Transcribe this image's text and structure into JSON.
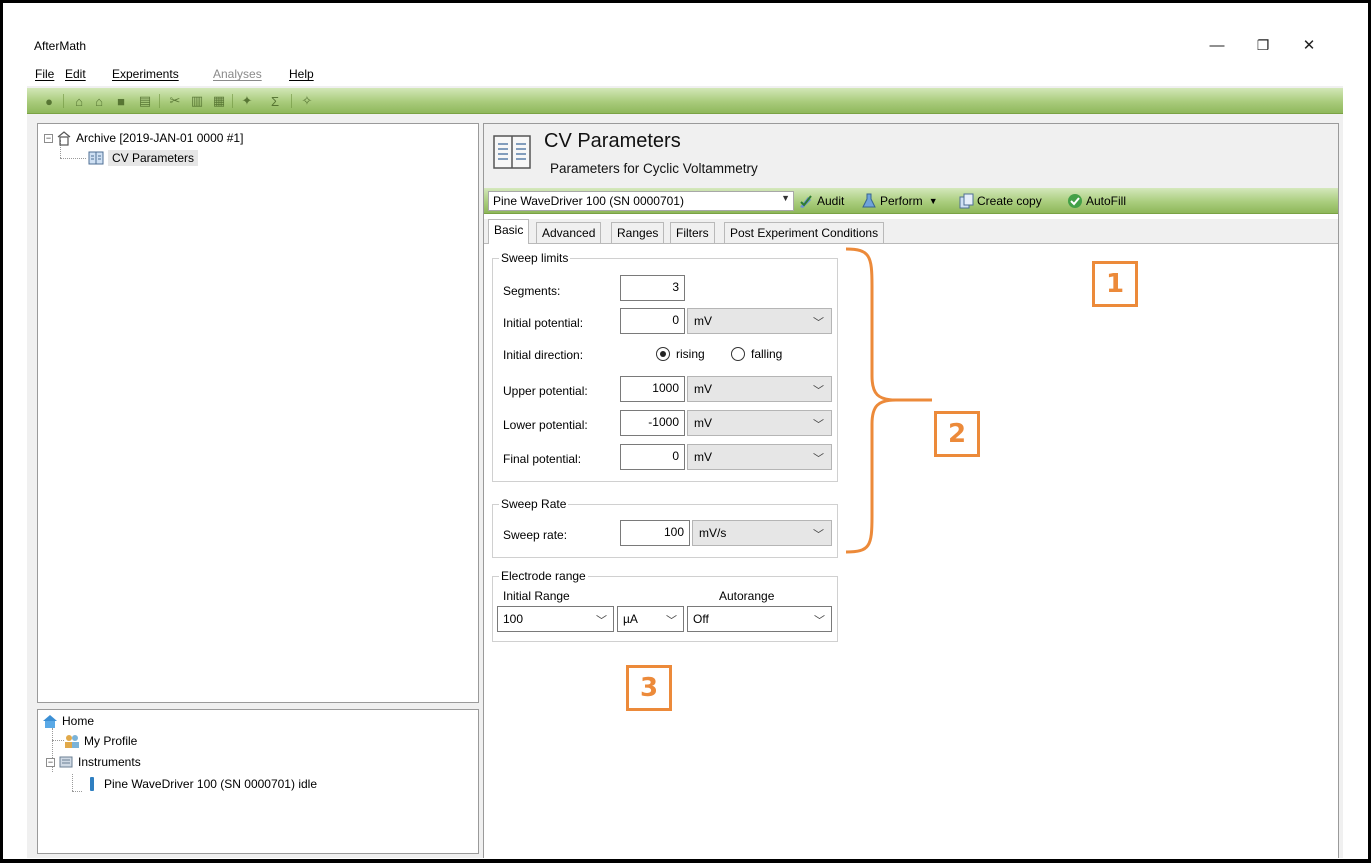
{
  "window": {
    "title": "AfterMath",
    "controls": [
      "—",
      "❐",
      "✕"
    ]
  },
  "menu": [
    {
      "label": "File",
      "enabled": true
    },
    {
      "label": "Edit",
      "enabled": true
    },
    {
      "label": "Experiments",
      "enabled": true
    },
    {
      "label": "Analyses",
      "enabled": false
    },
    {
      "label": "Help",
      "enabled": true
    }
  ],
  "toolbar": {
    "icons": [
      "back-icon",
      "archive-home-icon",
      "archive-up-icon",
      "save-icon",
      "print-icon",
      "cut-icon",
      "copy-icon",
      "paste-icon",
      "wizard-icon",
      "sigma-icon",
      "settings-icon"
    ],
    "sigma_glyph": "Σ"
  },
  "archive_tree": {
    "root": "Archive [2019-JAN-01 0000 #1]",
    "child": "CV Parameters"
  },
  "home_tree": {
    "home": "Home",
    "profile": "My Profile",
    "instruments": "Instruments",
    "instrument": "Pine WaveDriver 100 (SN 0000701) idle"
  },
  "page": {
    "title": "CV Parameters",
    "subtitle": "Parameters for Cyclic Voltammetry"
  },
  "actionbar": {
    "instrument": "Pine WaveDriver 100 (SN 0000701)",
    "audit": "Audit",
    "perform": "Perform",
    "create_copy": "Create copy",
    "autofill": "AutoFill"
  },
  "tabs": [
    "Basic",
    "Advanced",
    "Ranges",
    "Filters",
    "Post Experiment Conditions"
  ],
  "sweep_limits": {
    "legend": "Sweep limits",
    "segments_label": "Segments:",
    "segments": "3",
    "initial_potential_label": "Initial potential:",
    "initial_potential": "0",
    "initial_unit": "mV",
    "initial_direction_label": "Initial direction:",
    "rising": "rising",
    "falling": "falling",
    "upper_label": "Upper potential:",
    "upper": "1000",
    "upper_unit": "mV",
    "lower_label": "Lower potential:",
    "lower": "-1000",
    "lower_unit": "mV",
    "final_label": "Final potential:",
    "final": "0",
    "final_unit": "mV"
  },
  "sweep_rate": {
    "legend": "Sweep Rate",
    "label": "Sweep rate:",
    "value": "100",
    "unit": "mV/s"
  },
  "electrode_range": {
    "legend": "Electrode range",
    "initial_range_label": "Initial Range",
    "autorange_label": "Autorange",
    "initial_range": "100",
    "range_unit": "µA",
    "autorange": "Off"
  },
  "callouts": [
    "1",
    "2",
    "3"
  ],
  "colors": {
    "toolbar_green": "#a9cb7c",
    "callout_orange": "#ec8a3a"
  }
}
